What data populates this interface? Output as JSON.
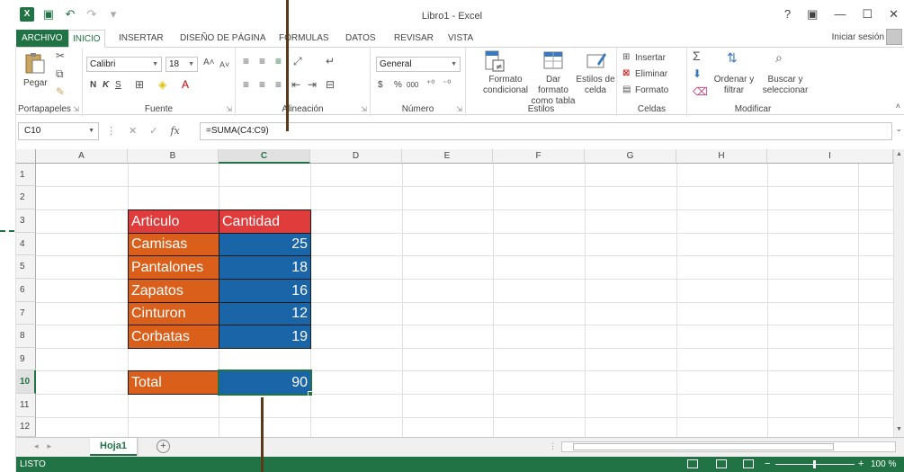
{
  "window": {
    "title": "Libro1 - Excel",
    "app_icon": "excel-logo-icon",
    "controls": [
      "?",
      "▣",
      "—",
      "☐",
      "✕"
    ]
  },
  "ribbon_tabs": [
    "ARCHIVO",
    "INICIO",
    "INSERTAR",
    "DISEÑO DE PÁGINA",
    "FÓRMULAS",
    "DATOS",
    "REVISAR",
    "VISTA"
  ],
  "active_tab": "INICIO",
  "signin": "Iniciar sesión",
  "ribbon": {
    "portapapeles": {
      "label": "Portapapeles",
      "paste": "Pegar"
    },
    "fuente": {
      "label": "Fuente",
      "font": "Calibri",
      "size": "18",
      "bold": "N",
      "italic": "K",
      "underline": "S"
    },
    "alineacion": {
      "label": "Alineación"
    },
    "numero": {
      "label": "Número",
      "format": "General",
      "currency": "$",
      "percent": "%",
      "thousands": "000"
    },
    "estilos": {
      "label": "Estilos",
      "conditional": "Formato condicional",
      "as_table": "Dar formato como tabla",
      "cell_styles": "Estilos de celda"
    },
    "celdas": {
      "label": "Celdas",
      "insert": "Insertar",
      "delete": "Eliminar",
      "format": "Formato"
    },
    "modificar": {
      "label": "Modificar",
      "sort": "Ordenar y filtrar",
      "find": "Buscar y seleccionar"
    }
  },
  "formula_bar": {
    "name_box": "C10",
    "formula": "=SUMA(C4:C9)",
    "fx": "fx"
  },
  "columns": [
    "A",
    "B",
    "C",
    "D",
    "E",
    "F",
    "G",
    "H",
    "I"
  ],
  "selected_column": "C",
  "rows": [
    "1",
    "2",
    "3",
    "4",
    "5",
    "6",
    "7",
    "8",
    "9",
    "10",
    "11",
    "12"
  ],
  "selected_row": "10",
  "table": {
    "header": {
      "articulo": "Articulo",
      "cantidad": "Cantidad"
    },
    "items": [
      {
        "articulo": "Camisas",
        "cantidad": "25"
      },
      {
        "articulo": "Pantalones",
        "cantidad": "18"
      },
      {
        "articulo": "Zapatos",
        "cantidad": "16"
      },
      {
        "articulo": "Cinturon",
        "cantidad": "12"
      },
      {
        "articulo": "Corbatas",
        "cantidad": "19"
      }
    ],
    "total": {
      "label": "Total",
      "value": "90"
    }
  },
  "colors": {
    "excel_green": "#217346",
    "header_red": "#e03c3c",
    "label_orange": "#d95f1a",
    "value_blue": "#1a64a8"
  },
  "sheet": {
    "name": "Hoja1"
  },
  "status": {
    "text": "LISTO",
    "zoom": "100 %"
  }
}
